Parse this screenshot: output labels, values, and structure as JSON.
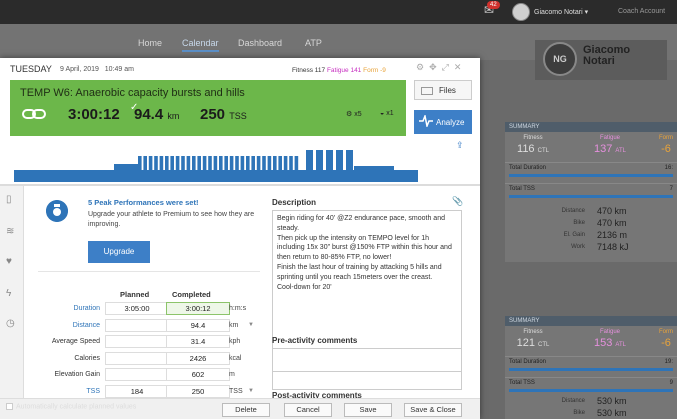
{
  "topbar": {
    "notification_count": "42",
    "user_name": "Giacomo Notari",
    "coach_account": "Coach Account"
  },
  "nav": {
    "items": [
      "Home",
      "Calendar",
      "Dashboard",
      "ATP"
    ],
    "active": "Calendar"
  },
  "brand": {
    "line1": "Giacomo",
    "line2": "Notari",
    "monogram": "NG"
  },
  "modal": {
    "day": "TUESDAY",
    "date": "9 April, 2019",
    "time": "10:49 am",
    "fitness_label": "Fitness",
    "fitness": "117",
    "fatigue_label": "Fatigue",
    "fatigue": "141",
    "form_label": "Form",
    "form": "-9",
    "workout_title": "TEMP W6: Anaerobic capacity bursts and hills",
    "duration": "3:00:12",
    "distance": "94.4",
    "distance_unit": "km",
    "tss": "250",
    "tss_unit": "TSS",
    "bike_count": "x5",
    "shoe_count": "x1",
    "files_label": "Files",
    "analyze_label": "Analyze",
    "peak_title": "5 Peak Performances were set!",
    "peak_text": "Upgrade your athlete to Premium to see how they are improving.",
    "upgrade_label": "Upgrade",
    "planned_header": "Planned",
    "completed_header": "Completed",
    "rows": [
      {
        "label": "Duration",
        "planned": "3:05:00",
        "completed": "3:00:12",
        "unit": "h:m:s",
        "link": true,
        "dropdown": false
      },
      {
        "label": "Distance",
        "planned": "",
        "completed": "94.4",
        "unit": "km",
        "link": true,
        "dropdown": true
      },
      {
        "label": "Average Speed",
        "planned": "",
        "completed": "31.4",
        "unit": "kph",
        "link": false,
        "dropdown": false
      },
      {
        "label": "Calories",
        "planned": "",
        "completed": "2426",
        "unit": "kcal",
        "link": false,
        "dropdown": false
      },
      {
        "label": "Elevation Gain",
        "planned": "",
        "completed": "602",
        "unit": "m",
        "link": false,
        "dropdown": false
      },
      {
        "label": "TSS",
        "planned": "184",
        "completed": "250",
        "unit": "TSS",
        "link": true,
        "dropdown": true
      }
    ],
    "description_title": "Description",
    "description": "Begin riding for 40' @Z2 endurance pace, smooth and steady.\nThen pick up the intensity on TEMPO level for 1h including 15x 30\" burst @150% FTP within this hour and then return to 80-85% FTP, no lower!\nFinish the last hour of training by attacking 5 hills and sprinting until you reach 15meters over the creast.\nCool-down for 20'",
    "pre_comments_title": "Pre-activity comments",
    "post_comments_title": "Post-activity comments",
    "auto_calc_label": "Automatically calculate planned values",
    "buttons": {
      "delete": "Delete",
      "cancel": "Cancel",
      "save": "Save",
      "save_close": "Save & Close"
    },
    "profile_blocks": [
      1,
      1,
      1,
      1,
      1,
      1,
      1,
      1,
      1,
      0,
      0,
      0,
      0,
      0,
      0,
      0,
      0,
      0,
      0,
      0,
      0,
      0,
      0,
      0,
      0,
      0,
      0,
      0,
      0,
      0,
      0,
      0,
      0,
      0,
      0,
      0,
      0,
      0,
      0,
      0,
      0,
      0,
      0,
      0,
      0,
      0,
      0,
      0,
      0,
      0,
      0,
      0
    ]
  },
  "summary1": {
    "title": "SUMMARY",
    "fitness_label": "Fitness",
    "fitness": "116",
    "fitness_unit": "CTL",
    "fatigue_label": "Fatigue",
    "fatigue": "137",
    "fatigue_unit": "ATL",
    "form_label": "Form",
    "form": "-6",
    "total_duration_label": "Total Duration",
    "total_duration": "16:",
    "total_tss_label": "Total TSS",
    "total_tss": "7",
    "kvs": [
      {
        "k": "Distance",
        "v": "470 km"
      },
      {
        "k": "Bike",
        "v": "470 km"
      },
      {
        "k": "El. Gain",
        "v": "2136 m"
      },
      {
        "k": "Work",
        "v": "7148 kJ"
      }
    ]
  },
  "summary2": {
    "title": "SUMMARY",
    "fitness_label": "Fitness",
    "fitness": "121",
    "fitness_unit": "CTL",
    "fatigue_label": "Fatigue",
    "fatigue": "153",
    "fatigue_unit": "ATL",
    "form_label": "Form",
    "form": "-6",
    "total_duration_label": "Total Duration",
    "total_duration": "19:",
    "total_tss_label": "Total TSS",
    "total_tss": "9",
    "kvs": [
      {
        "k": "Distance",
        "v": "530 km"
      },
      {
        "k": "Bike",
        "v": "530 km"
      }
    ]
  },
  "colors": {
    "green": "#6cb74a",
    "blue": "#3d7fc7",
    "fatigue": "#c72fc0",
    "form": "#e8a33a"
  }
}
